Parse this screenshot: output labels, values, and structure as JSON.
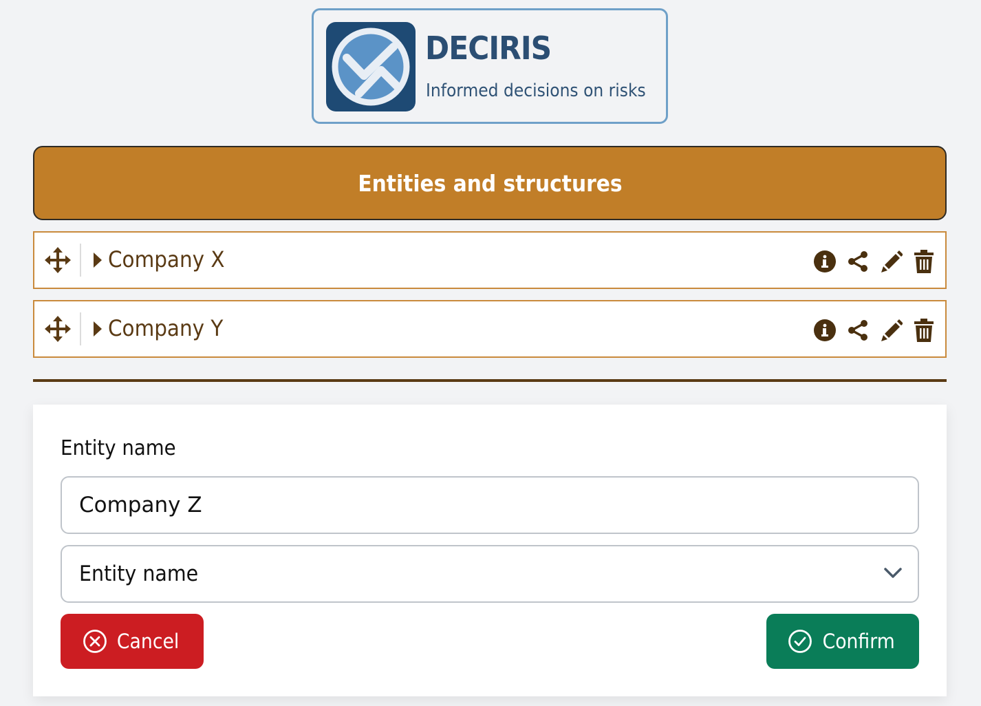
{
  "brand": {
    "name": "DECIRIS",
    "tagline": "Informed decisions on risks",
    "colors": {
      "primary": "#1e4a74",
      "accent": "#c17e28"
    }
  },
  "section": {
    "title": "Entities and structures"
  },
  "entities": [
    {
      "name": "Company X",
      "actions": [
        "info-icon",
        "share-icon",
        "edit-icon",
        "trash-icon"
      ]
    },
    {
      "name": "Company Y",
      "actions": [
        "info-icon",
        "share-icon",
        "edit-icon",
        "trash-icon"
      ]
    }
  ],
  "form": {
    "label": "Entity name",
    "name_value": "Company Z",
    "select_value": "Entity name",
    "cancel_label": "Cancel",
    "confirm_label": "Confirm",
    "colors": {
      "cancel": "#cc1d22",
      "confirm": "#0a7d58"
    }
  }
}
